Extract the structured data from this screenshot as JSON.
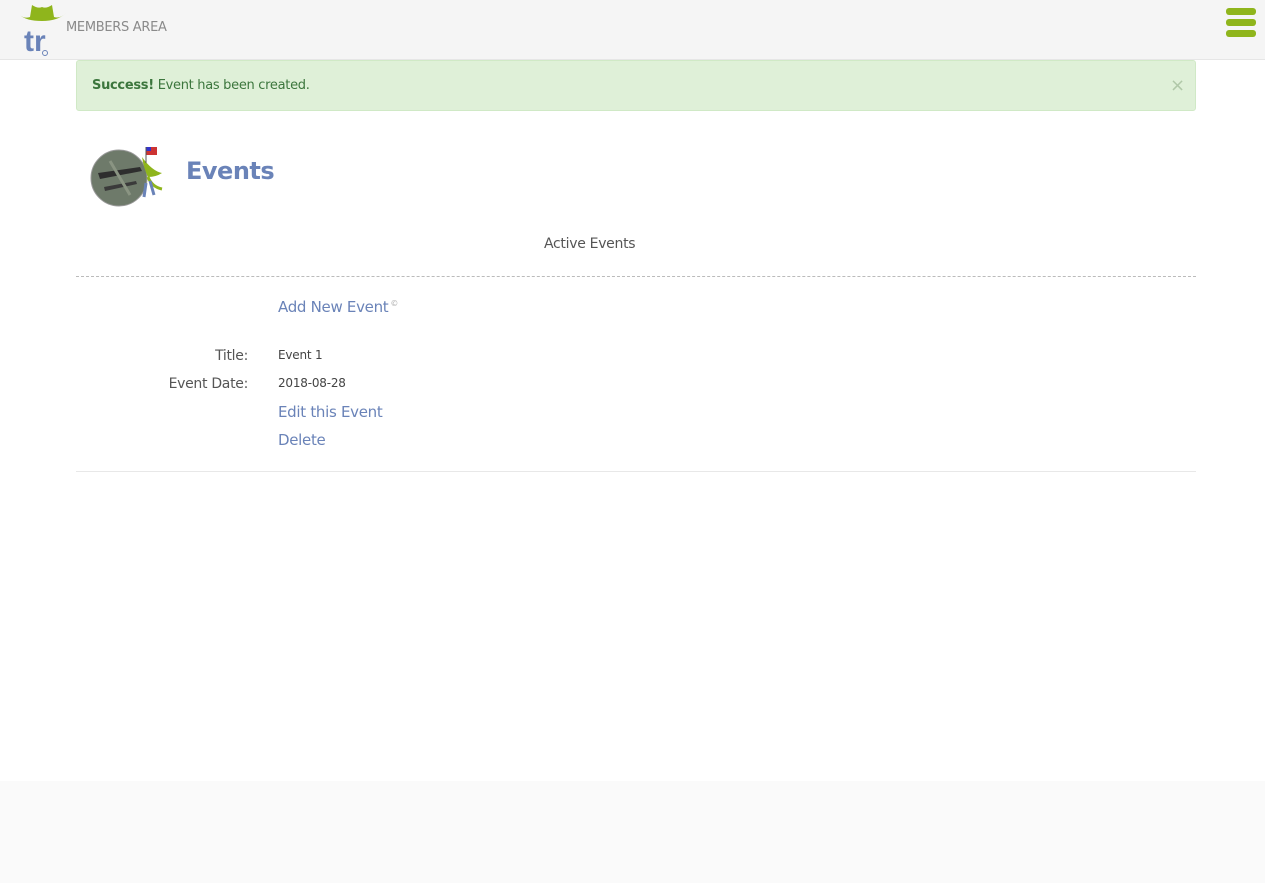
{
  "header": {
    "logo_text": "tr",
    "brand_label": "MEMBERS AREA"
  },
  "alert": {
    "strong": "Success!",
    "message": " Event has been created.",
    "close": "×"
  },
  "page": {
    "title": "Events",
    "section_label": "Active Events",
    "add_link": "Add New Event",
    "add_link_mark": "©"
  },
  "event": {
    "title_label": "Title:",
    "title_value": "Event 1",
    "date_label": "Event Date:",
    "date_value": "2018-08-28",
    "edit_link": "Edit this Event",
    "delete_link": "Delete"
  },
  "colors": {
    "accent_green": "#8fb51c",
    "link_blue": "#6a83b8",
    "success_bg": "#dff0d8",
    "success_text": "#3c763d"
  }
}
